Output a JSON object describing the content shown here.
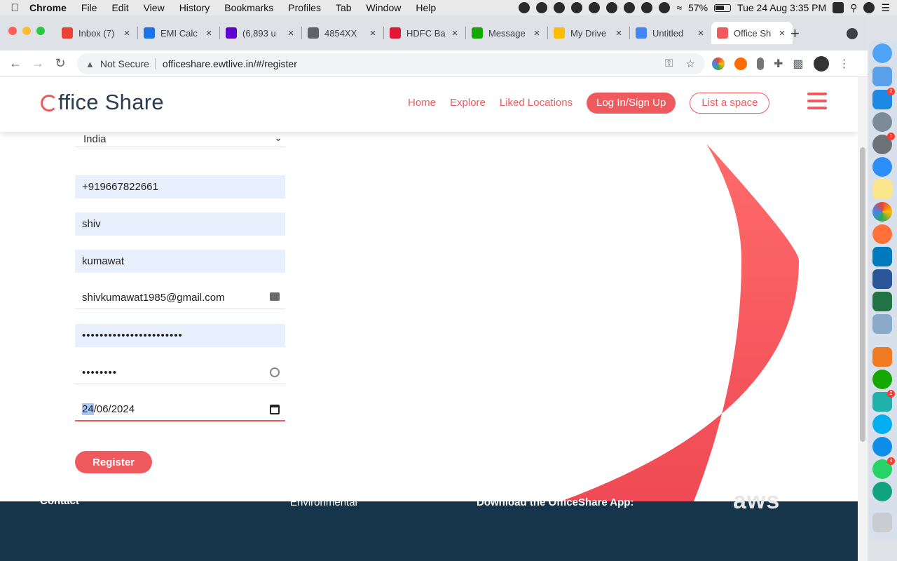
{
  "menubar": {
    "app": "Chrome",
    "items": [
      "File",
      "Edit",
      "View",
      "History",
      "Bookmarks",
      "Profiles",
      "Tab",
      "Window",
      "Help"
    ],
    "battery": "57%",
    "clock": "Tue 24 Aug  3:35 PM"
  },
  "tabs": [
    {
      "title": "Inbox (7)",
      "color": "#ea4335"
    },
    {
      "title": "EMI Calc",
      "color": "#1a73e8"
    },
    {
      "title": "(6,893 u",
      "color": "#6001d2"
    },
    {
      "title": "4854XX",
      "color": "#5f6368"
    },
    {
      "title": "HDFC Ba",
      "color": "#e31837"
    },
    {
      "title": "Message",
      "color": "#14a800"
    },
    {
      "title": "My Drive",
      "color": "#fbbc04"
    },
    {
      "title": "Untitled",
      "color": "#4285f4"
    },
    {
      "title": "Office Sh",
      "color": "#ef5a5f",
      "active": true
    }
  ],
  "address": {
    "security": "Not Secure",
    "url": "officeshare.ewtlive.in/#/register"
  },
  "site": {
    "logo_rest": "ffice Share",
    "nav": {
      "home": "Home",
      "explore": "Explore",
      "liked": "Liked Locations",
      "login": "Log In/Sign Up",
      "list_space": "List a space"
    }
  },
  "form": {
    "country": "India",
    "phone": "+919667822661",
    "first_name": "shiv",
    "last_name": "kumawat",
    "email": "shivkumawat1985@gmail.com",
    "password_mask": "•••••••••••••••••••••••",
    "confirm_mask": "••••••••",
    "date_day": "24",
    "date_rest": "/06/2024",
    "register": "Register"
  },
  "footer": {
    "contact": "Contact",
    "environmental": "Environmental",
    "download": "Download the OfficeShare App:",
    "aws": "aws"
  },
  "colors": {
    "brand": "#ef5a5f",
    "footer": "#16344a",
    "autofill": "#e8f0fe"
  }
}
